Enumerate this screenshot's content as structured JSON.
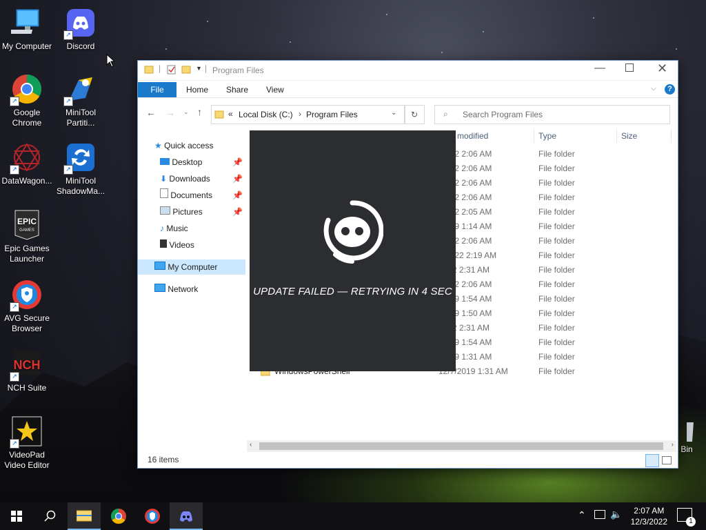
{
  "desktop": {
    "icons": [
      {
        "label": "My Computer"
      },
      {
        "label": "Discord"
      },
      {
        "label": "Google Chrome"
      },
      {
        "label": "MiniTool Partiti..."
      },
      {
        "label": "DataWagon..."
      },
      {
        "label": "MiniTool ShadowMa..."
      },
      {
        "label": "Epic Games Launcher"
      },
      {
        "label": "AVG Secure Browser"
      },
      {
        "label": "NCH Suite"
      },
      {
        "label": "VideoPad Video Editor"
      },
      {
        "label": "e Bin"
      }
    ]
  },
  "explorer": {
    "title": "Program Files",
    "ribbon": {
      "file": "File",
      "home": "Home",
      "share": "Share",
      "view": "View"
    },
    "address": {
      "prefix": "«",
      "crumb1": "Local Disk (C:)",
      "crumb2": "Program Files"
    },
    "search_placeholder": "Search Program Files",
    "nav": {
      "quick_access": "Quick access",
      "desktop": "Desktop",
      "downloads": "Downloads",
      "documents": "Documents",
      "pictures": "Pictures",
      "music": "Music",
      "videos": "Videos",
      "my_computer": "My Computer",
      "network": "Network"
    },
    "columns": {
      "modified": "modified",
      "type": "Type",
      "size": "Size"
    },
    "rows": [
      {
        "name": "",
        "date": "/2022 2:06 AM",
        "type": "File folder"
      },
      {
        "name": "",
        "date": "/2022 2:06 AM",
        "type": "File folder"
      },
      {
        "name": "",
        "date": "/2022 2:06 AM",
        "type": "File folder"
      },
      {
        "name": "",
        "date": "/2022 2:06 AM",
        "type": "File folder"
      },
      {
        "name": "",
        "date": "/2022 2:05 AM",
        "type": "File folder"
      },
      {
        "name": "",
        "date": "/2019 1:14 AM",
        "type": "File folder"
      },
      {
        "name": "",
        "date": "/2022 2:06 AM",
        "type": "File folder"
      },
      {
        "name": "",
        "date": "3/2022 2:19 AM",
        "type": "File folder"
      },
      {
        "name": "",
        "date": "2022 2:31 AM",
        "type": "File folder"
      },
      {
        "name": "",
        "date": "/2022 2:06 AM",
        "type": "File folder"
      },
      {
        "name": "",
        "date": "/2019 1:54 AM",
        "type": "File folder"
      },
      {
        "name": "",
        "date": "/2019 1:50 AM",
        "type": "File folder"
      },
      {
        "name": "",
        "date": "2022 2:31 AM",
        "type": "File folder"
      },
      {
        "name": "",
        "date": "/2019 1:54 AM",
        "type": "File folder"
      },
      {
        "name": "",
        "date": "/2019 1:31 AM",
        "type": "File folder"
      },
      {
        "name": "WindowsPowerShell",
        "date": "12/7/2019 1:31 AM",
        "type": "File folder"
      }
    ],
    "status": "16 items"
  },
  "overlay": {
    "message": "UPDATE FAILED — RETRYING IN 4 SEC"
  },
  "taskbar": {
    "time": "2:07 AM",
    "date": "12/3/2022",
    "notif_count": "1"
  }
}
